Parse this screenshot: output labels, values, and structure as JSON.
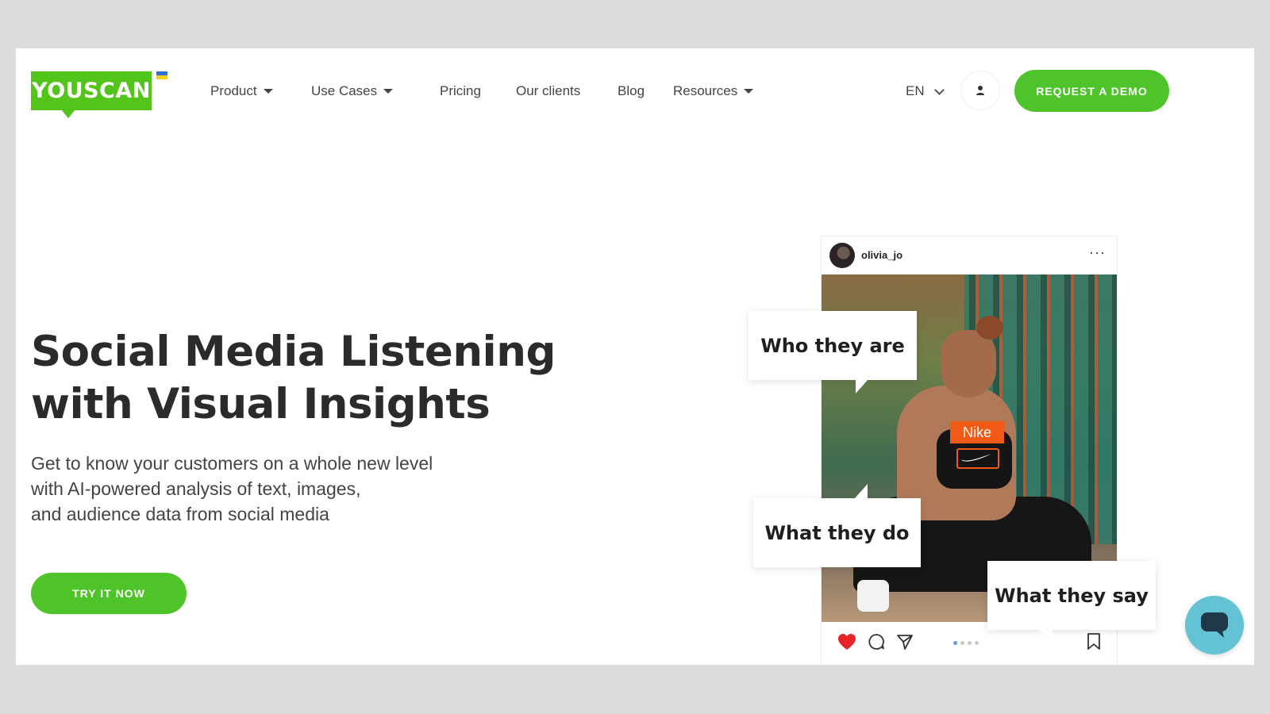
{
  "header": {
    "logo_text": "YOUSCAN",
    "nav": [
      {
        "label": "Product",
        "has_dropdown": true
      },
      {
        "label": "Use Cases",
        "has_dropdown": true
      },
      {
        "label": "Pricing",
        "has_dropdown": false
      },
      {
        "label": "Our clients",
        "has_dropdown": false
      },
      {
        "label": "Blog",
        "has_dropdown": false
      },
      {
        "label": "Resources",
        "has_dropdown": true
      }
    ],
    "language": "EN",
    "demo_button": "REQUEST A DEMO"
  },
  "hero": {
    "title_line1": "Social Media Listening",
    "title_line2": "with Visual Insights",
    "subtitle_lines": [
      "Get to know your customers on a whole new level",
      "with AI-powered analysis of text, images,",
      "and audience data from social media"
    ],
    "cta": "TRY IT NOW"
  },
  "post": {
    "username": "olivia_jo",
    "menu": "···",
    "brand_tag": "Nike",
    "callouts": [
      "Who they are",
      "What they do",
      "What they say"
    ]
  },
  "colors": {
    "brand_green": "#4fc42a",
    "logo_green": "#53c41a",
    "nike_orange": "#f15a14",
    "chat_teal": "#63c2d4",
    "heart_red": "#e8232a"
  }
}
